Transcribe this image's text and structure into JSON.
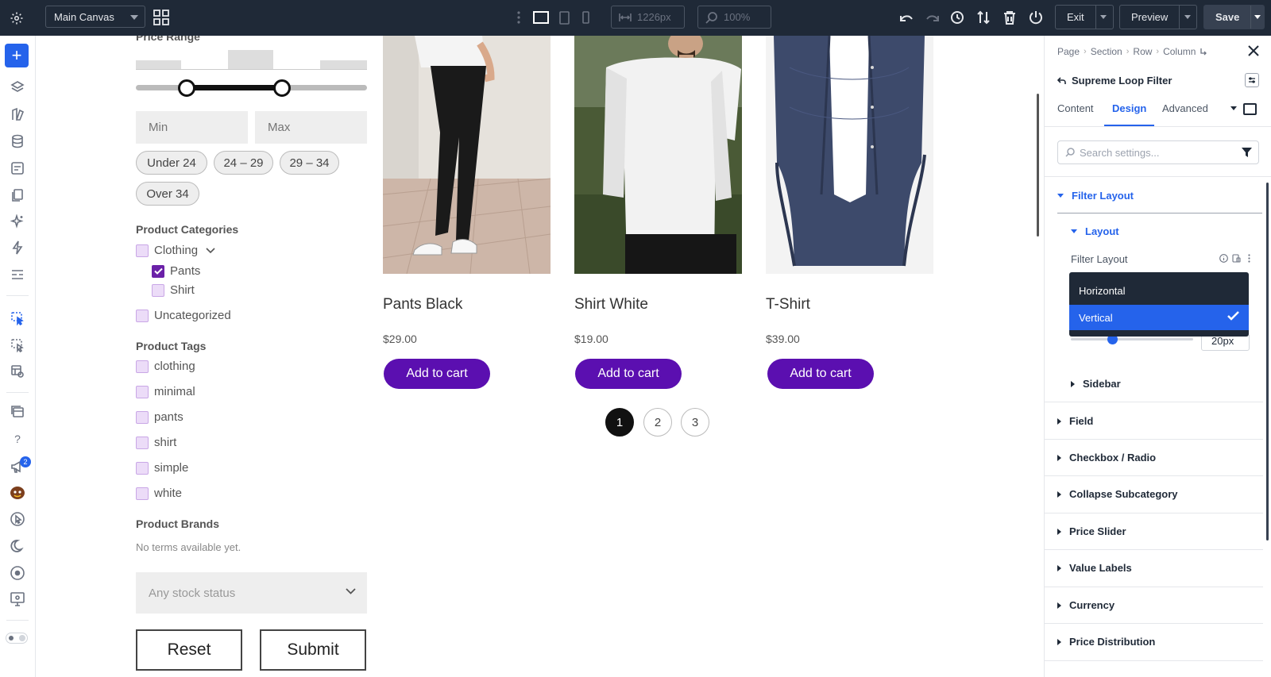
{
  "topbar": {
    "canvas_name": "Main Canvas",
    "width_value": "1226px",
    "zoom_value": "100%",
    "exit_label": "Exit",
    "preview_label": "Preview",
    "save_label": "Save"
  },
  "left_toolbar": {
    "notification_count": "2"
  },
  "filter": {
    "price_range_title": "Price Range",
    "min_placeholder": "Min",
    "max_placeholder": "Max",
    "price_chips": [
      "Under 24",
      "24 – 29",
      "29 – 34",
      "Over 34"
    ],
    "categories_title": "Product Categories",
    "categories": [
      {
        "label": "Clothing",
        "checked": false
      },
      {
        "label": "Pants",
        "checked": true
      },
      {
        "label": "Shirt",
        "checked": false
      },
      {
        "label": "Uncategorized",
        "checked": false
      }
    ],
    "tags_title": "Product Tags",
    "tags": [
      "clothing",
      "minimal",
      "pants",
      "shirt",
      "simple",
      "white"
    ],
    "brands_title": "Product Brands",
    "brands_empty": "No terms available yet.",
    "stock_placeholder": "Any stock status",
    "reset_label": "Reset",
    "submit_label": "Submit"
  },
  "products": [
    {
      "name": "Pants Black",
      "price": "$29.00",
      "cart_label": "Add to cart"
    },
    {
      "name": "Shirt White",
      "price": "$19.00",
      "cart_label": "Add to cart"
    },
    {
      "name": "T-Shirt",
      "price": "$39.00",
      "cart_label": "Add to cart"
    }
  ],
  "pagination": [
    "1",
    "2",
    "3"
  ],
  "panel": {
    "breadcrumb": [
      "Page",
      "Section",
      "Row",
      "Column"
    ],
    "module_title": "Supreme Loop Filter",
    "tabs": [
      "Content",
      "Design",
      "Advanced"
    ],
    "active_tab": "Design",
    "search_placeholder": "Search settings...",
    "open_group": "Filter Layout",
    "sub_group": "Layout",
    "field_label": "Filter Layout",
    "dropdown_options": [
      "Horizontal",
      "Vertical"
    ],
    "selected_option": "Vertical",
    "range_value": "20px",
    "sidebar_group": "Sidebar",
    "groups": [
      "Field",
      "Checkbox / Radio",
      "Collapse Subcategory",
      "Price Slider",
      "Value Labels",
      "Currency",
      "Price Distribution"
    ]
  },
  "colors": {
    "accent": "#2563eb",
    "topbar_bg": "#1f2937",
    "cart_button": "#5b0fb0"
  }
}
